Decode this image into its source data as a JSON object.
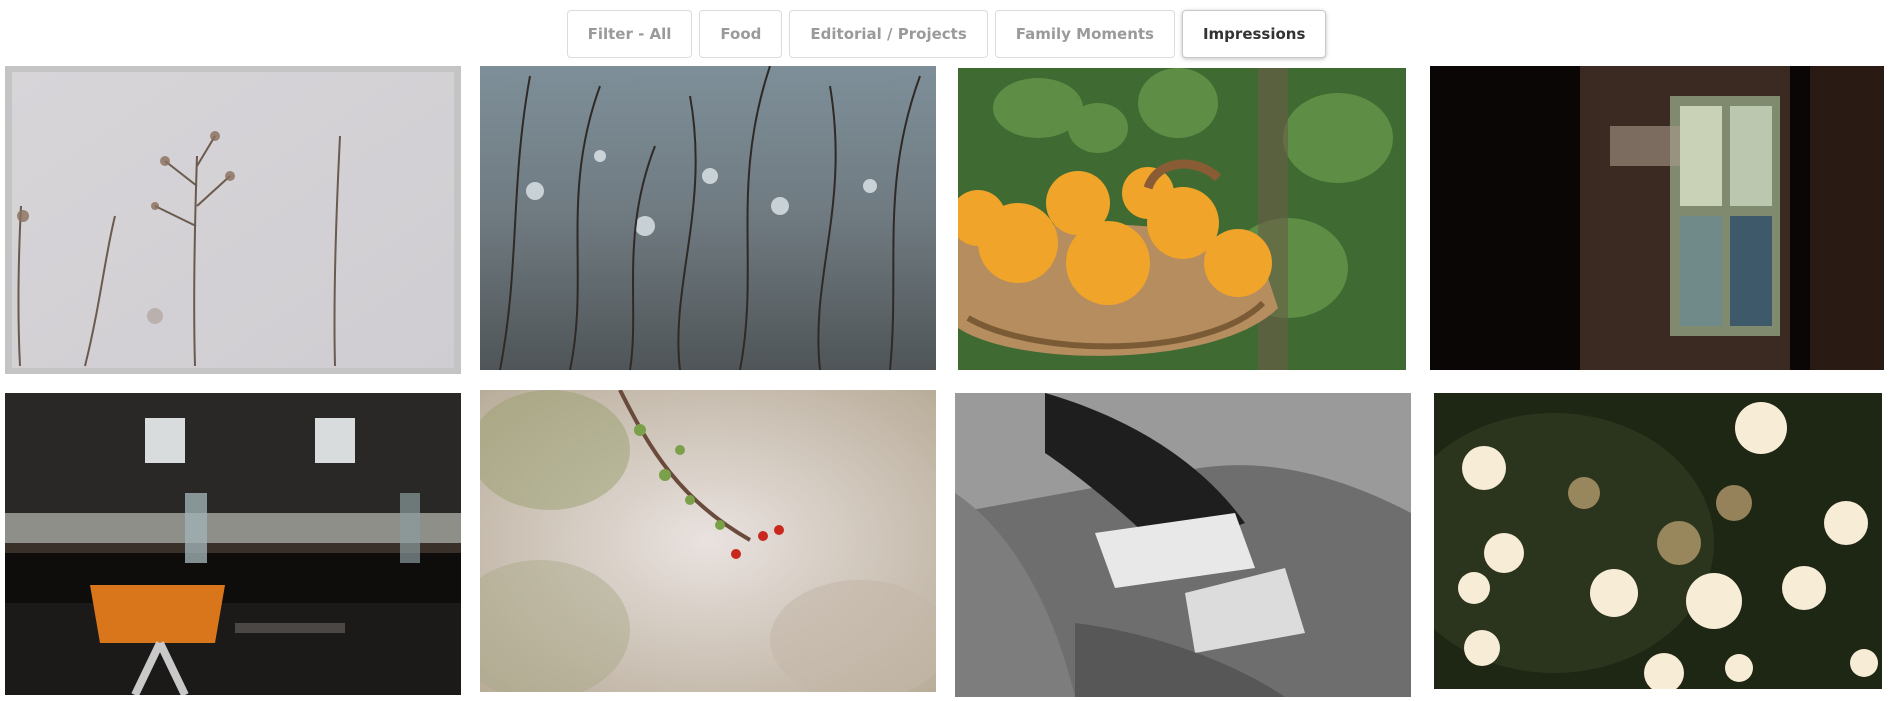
{
  "filters": [
    {
      "label": "Filter - All",
      "active": false
    },
    {
      "label": "Food",
      "active": false
    },
    {
      "label": "Editorial / Projects",
      "active": false
    },
    {
      "label": "Family Moments",
      "active": false
    },
    {
      "label": "Impressions",
      "active": true
    }
  ],
  "gallery": {
    "photos": [
      {
        "subject": "dried grass stems on pale grey background"
      },
      {
        "subject": "bare branches with water bokeh"
      },
      {
        "subject": "basket of oranges with leaves"
      },
      {
        "subject": "blurred dark window frame"
      },
      {
        "subject": "cafe interior with orange chair"
      },
      {
        "subject": "blossom branch with red berries"
      },
      {
        "subject": "black and white person reading a book"
      },
      {
        "subject": "warm bokeh lights on dark green"
      }
    ]
  }
}
